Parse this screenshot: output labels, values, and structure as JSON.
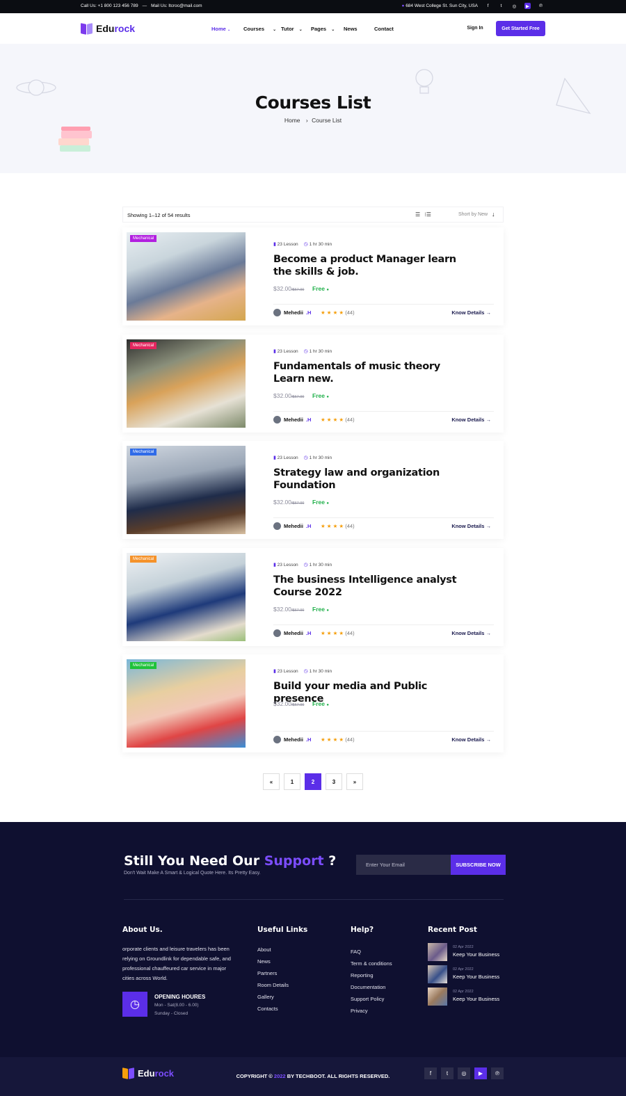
{
  "topbar": {
    "call": "Call Us: +1 800 123 456 789",
    "dash": "—",
    "mail": "Mail Us: ltcroc@mail.com",
    "address": "684 West College St. Sun City, USA"
  },
  "brand": {
    "part1": "Edu",
    "part2": "rock"
  },
  "nav": {
    "items": [
      "Home",
      "Courses",
      "Tutor",
      "Pages",
      "News",
      "Contact"
    ],
    "signin": "Sign In",
    "cta": "Get Started Free"
  },
  "hero": {
    "title": "Courses List",
    "crumb_home": "Home",
    "crumb_current": "Course List"
  },
  "toolbar": {
    "results": "Showing 1–12 of 54 results",
    "sort": "Short by New"
  },
  "courses": [
    {
      "tag": "Mechanical",
      "tag_color": "#b21fe0",
      "lessons": "23 Lesson",
      "duration": "1 hr 30 min",
      "title": "Become a product Manager learn the skills & job.",
      "price": "$32.00",
      "old_price": "/$67.00",
      "free": "Free",
      "author_first": "Mehedii",
      "author_last": ".H",
      "stars": "★ ★ ★ ★",
      "reviews": "(44)",
      "cta": "Know Details →"
    },
    {
      "tag": "Mechanical",
      "tag_color": "#e5265f",
      "lessons": "23 Lesson",
      "duration": "1 hr 30 min",
      "title": "Fundamentals of music theory Learn new.",
      "price": "$32.00",
      "old_price": "/$67.00",
      "free": "Free",
      "author_first": "Mehedii",
      "author_last": ".H",
      "stars": "★ ★ ★ ★",
      "reviews": "(44)",
      "cta": "Know Details →"
    },
    {
      "tag": "Mechanical",
      "tag_color": "#2f6be8",
      "lessons": "23 Lesson",
      "duration": "1 hr 30 min",
      "title": "Strategy law and organization Foundation",
      "price": "$32.00",
      "old_price": "/$67.00",
      "free": "Free",
      "author_first": "Mehedii",
      "author_last": ".H",
      "stars": "★ ★ ★ ★",
      "reviews": "(44)",
      "cta": "Know Details →"
    },
    {
      "tag": "Mechanical",
      "tag_color": "#f5922a",
      "lessons": "23 Lesson",
      "duration": "1 hr 30 min",
      "title": "The business Intelligence analyst Course 2022",
      "price": "$32.00",
      "old_price": "/$67.00",
      "free": "Free",
      "author_first": "Mehedii",
      "author_last": ".H",
      "stars": "★ ★ ★ ★",
      "reviews": "(44)",
      "cta": "Know Details →"
    },
    {
      "tag": "Mechanical",
      "tag_color": "#1fc23a",
      "lessons": "23 Lesson",
      "duration": "1 hr 30 min",
      "title": "Build your media and Public presence",
      "price": "$32.00",
      "old_price": "/$67.00",
      "free": "Free",
      "author_first": "Mehedii",
      "author_last": ".H",
      "stars": "★ ★ ★ ★",
      "reviews": "(44)",
      "cta": "Know Details →"
    }
  ],
  "pagination": {
    "prev": "«",
    "pages": [
      "1",
      "2",
      "3"
    ],
    "current": "2",
    "next": "»"
  },
  "newsletter": {
    "title_a": "Still You Need Our ",
    "title_b": "Support",
    "title_c": " ?",
    "subtitle": "Don't Wait Make A Smart & Logical Quote Here. Its Pretty Easy.",
    "placeholder": "Enter Your Email",
    "button": "SUBSCRIBE NOW"
  },
  "about": {
    "heading": "About Us.",
    "text": "orporate clients and leisure travelers has been relying on Groundlink for dependable safe, and professional chauffeured car service in major cities across World.",
    "hours_title": "OPENING HOURES",
    "hours_1": "Mon - Sat(8.00 - 6.00)",
    "hours_2": "Sunday - Closed"
  },
  "useful_links": {
    "heading": "Useful Links",
    "items": [
      "About",
      "News",
      "Partners",
      "Room Details",
      "Gallery",
      "Contacts"
    ]
  },
  "help": {
    "heading": "Help?",
    "items": [
      "FAQ",
      "Term & conditions",
      "Reporting",
      "Documentation",
      "Support Policy",
      "Privacy"
    ]
  },
  "recent": {
    "heading": "Recent Post",
    "items": [
      {
        "date": "02 Apr 2022",
        "title": "Keep Your Business"
      },
      {
        "date": "02 Apr 2022",
        "title": "Keep Your Business"
      },
      {
        "date": "02 Apr 2022",
        "title": "Keep Your Business"
      }
    ]
  },
  "copyright": {
    "a": "COPYRIGHT © ",
    "year": "2022",
    "b": " BY TECHBOOT. ALL RIGHTS RESERVED."
  },
  "colors": {
    "accent": "#5b2ee8",
    "footer_bg": "#0f1030"
  },
  "icons": [
    "location-icon",
    "facebook-icon",
    "twitter-icon",
    "instagram-icon",
    "youtube-icon",
    "pinterest-icon",
    "book-icon",
    "clock-icon",
    "user-icon",
    "list-view-icon",
    "grid-view-icon",
    "sort-arrow-icon"
  ]
}
